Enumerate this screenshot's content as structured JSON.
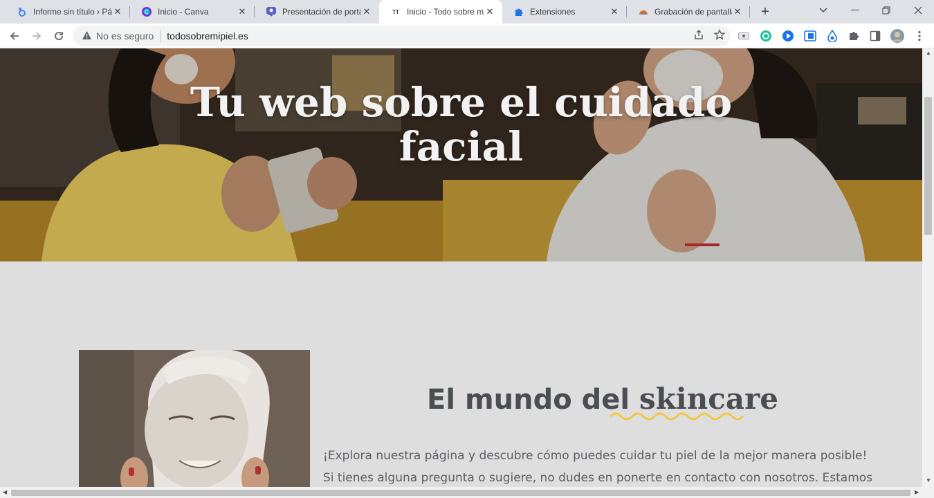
{
  "tabs": [
    {
      "title": "Informe sin título › Pág",
      "icon": "looker-studio-icon",
      "color": "#4285f4"
    },
    {
      "title": "Inicio - Canva",
      "icon": "canva-icon",
      "color": "#7d2ae8"
    },
    {
      "title": "Presentación de porta",
      "icon": "slides-icon",
      "color": "#5b5fc7"
    },
    {
      "title": "Inicio - Todo sobre m",
      "icon": "site-icon",
      "color": "#333333"
    },
    {
      "title": "Extensiones",
      "icon": "puzzle-icon",
      "color": "#1a73e8"
    },
    {
      "title": "Grabación de pantalla",
      "icon": "recorder-icon",
      "color": "#e8710a"
    }
  ],
  "address": {
    "security_label": "No es seguro",
    "url": "todosobremipiel.es"
  },
  "hero": {
    "title_line1": "Tu web sobre el cuidado",
    "title_line2": "facial"
  },
  "section": {
    "title_plain": "El mundo del",
    "title_highlight": "skincare",
    "paragraph_line1": "¡Explora nuestra página y descubre cómo puedes cuidar tu piel de la mejor manera posible!",
    "paragraph_line2": "Si tienes alguna pregunta o sugiere, no dudes en ponerte en contacto con nosotros. Estamos"
  },
  "colors": {
    "accent_squiggle": "#f2c744",
    "tab_strip": "#dee1e6"
  }
}
